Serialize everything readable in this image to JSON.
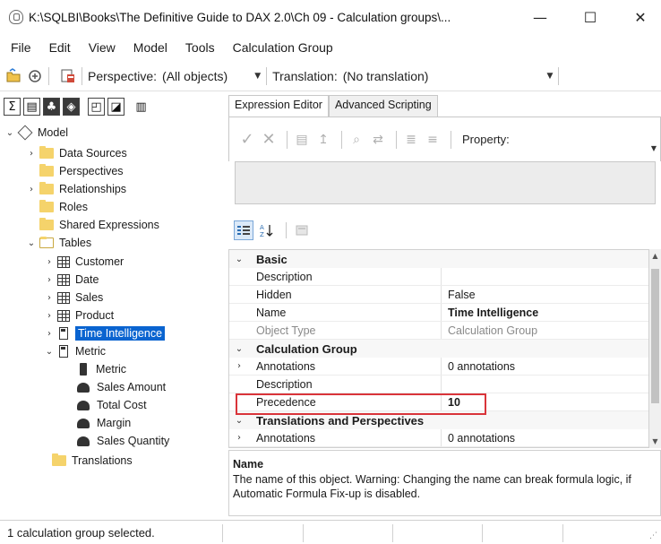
{
  "window": {
    "title": "K:\\SQLBI\\Books\\The Definitive Guide to DAX 2.0\\Ch 09 - Calculation groups\\...",
    "minimize": "—",
    "maximize": "☐",
    "close": "✕"
  },
  "menu": {
    "items": [
      "File",
      "Edit",
      "View",
      "Model",
      "Tools",
      "Calculation Group"
    ]
  },
  "toolbar": {
    "perspective_label": "Perspective:",
    "perspective_value": "(All objects)",
    "translation_label": "Translation:",
    "translation_value": "(No translation)"
  },
  "tree": {
    "root": "Model",
    "data_sources": "Data Sources",
    "perspectives": "Perspectives",
    "relationships": "Relationships",
    "roles": "Roles",
    "shared_expressions": "Shared Expressions",
    "tables": "Tables",
    "customer": "Customer",
    "date": "Date",
    "sales": "Sales",
    "product": "Product",
    "time_intelligence": "Time Intelligence",
    "metric": "Metric",
    "metric_column": "Metric",
    "sales_amount": "Sales Amount",
    "total_cost": "Total Cost",
    "margin": "Margin",
    "sales_quantity": "Sales Quantity",
    "translations": "Translations"
  },
  "tabs": {
    "expression_editor": "Expression Editor",
    "advanced_scripting": "Advanced Scripting"
  },
  "expression": {
    "property_label": "Property:"
  },
  "properties": {
    "basic": "Basic",
    "description_1": "Description",
    "hidden": "Hidden",
    "hidden_value": "False",
    "name": "Name",
    "name_value": "Time Intelligence",
    "object_type": "Object Type",
    "object_type_value": "Calculation Group",
    "calculation_group": "Calculation Group",
    "annotations_1": "Annotations",
    "annotations_1_value": "0 annotations",
    "description_2": "Description",
    "precedence": "Precedence",
    "precedence_value": "10",
    "translations_perspectives": "Translations and Perspectives",
    "annotations_2": "Annotations",
    "annotations_2_value": "0 annotations"
  },
  "description_panel": {
    "title": "Name",
    "text": "The name of this object. Warning: Changing the name can break formula logic, if Automatic Formula Fix-up is disabled."
  },
  "status": {
    "text": "1 calculation group selected."
  }
}
